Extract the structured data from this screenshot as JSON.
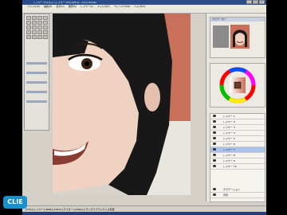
{
  "window": {
    "title": "レイヤー 2/スキャンレイヤー 2/0 [100%] - ComicStudio",
    "controls": [
      "_",
      "□",
      "×"
    ]
  },
  "menubar": {
    "items": [
      "ファイル(F)",
      "編集(E)",
      "表示(V)",
      "選択(S)",
      "レイヤー(L)",
      "フィルタ(T)",
      "ウィンドウ(W)",
      "ヘルプ(H)"
    ]
  },
  "navigator": {
    "title": "ナビゲーター"
  },
  "color": {
    "accent": "#c96f58",
    "swatch": "#6a3a26"
  },
  "layers": {
    "items": [
      "レイヤー 1",
      "レイヤー 2",
      "レイヤー 3",
      "レイヤー 4",
      "レイヤー 5",
      "レイヤー 6",
      "レイヤー 7",
      "レイヤー 8",
      "レイヤー 9",
      "レイヤー 10"
    ],
    "selected": "レイヤー 7",
    "extra": "グラデーション",
    "extra2": "背景"
  },
  "statusbar": {
    "text": "[CH1] [レイヤー] [RGB] [100%] [ラスター] [24bit] ドラッグでブラシサイズ変更"
  },
  "logo": {
    "text": "CLIE"
  }
}
